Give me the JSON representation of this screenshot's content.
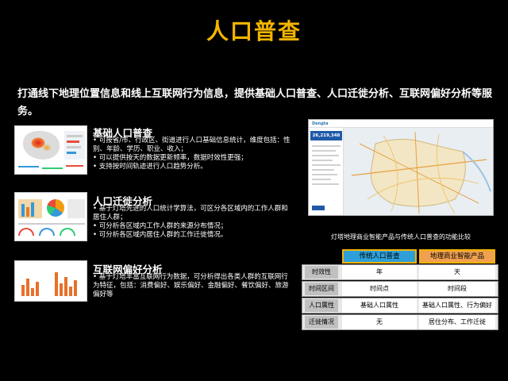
{
  "title": "人口普查",
  "intro": "打通线下地理位置信息和线上互联网行为信息，提供基础人口普查、人口迁徙分析、互联网偏好分析等服务。",
  "sections": [
    {
      "title": "基础人口普查",
      "bullets": [
        "可按省/市、行政区、街道进行人口基础信息统计，维度包括：性别、年龄、学历、职业、收入；",
        "可以提供按天的数据更新频率，数据时效性更强；",
        "支持按时间轨迹进行人口趋势分析。"
      ]
    },
    {
      "title": "人口迁徙分析",
      "bullets": [
        "基于灯塔先进的人口统计学算法，可区分各区域内的工作人群和居住人群；",
        "可分析各区域内工作人群的来源分布情况；",
        "可分析各区域内居住人群的工作迁徙情况。"
      ]
    },
    {
      "title": "互联网偏好分析",
      "bullets": [
        "基于灯塔丰富互联网行为数据，可分析得出各类人群的互联网行为特征，包括：消费偏好、娱乐偏好、金融偏好、餐饮偏好、旅游偏好等"
      ]
    }
  ],
  "map_screenshot": {
    "logo": "Dengta",
    "count": "26,219,348人"
  },
  "caption": "灯塔地理商业智能产品与传统人口普查的功能比较",
  "comparison": {
    "headers": [
      "传统人口普查",
      "地理商业智能产品"
    ],
    "rows": [
      {
        "label": "时效性",
        "traditional": "年",
        "smart": "天"
      },
      {
        "label": "时间区间",
        "traditional": "时间点",
        "smart": "时间段"
      },
      {
        "label": "人口属性",
        "traditional": "基础人口属性",
        "smart": "基础人口属性、行为偏好"
      },
      {
        "label": "迁徙情况",
        "traditional": "无",
        "smart": "居住分布、工作迁徙"
      }
    ]
  },
  "colors": {
    "title": "#f4b400",
    "header_blue": "#2e9fd8",
    "header_orange": "#f0a050"
  }
}
